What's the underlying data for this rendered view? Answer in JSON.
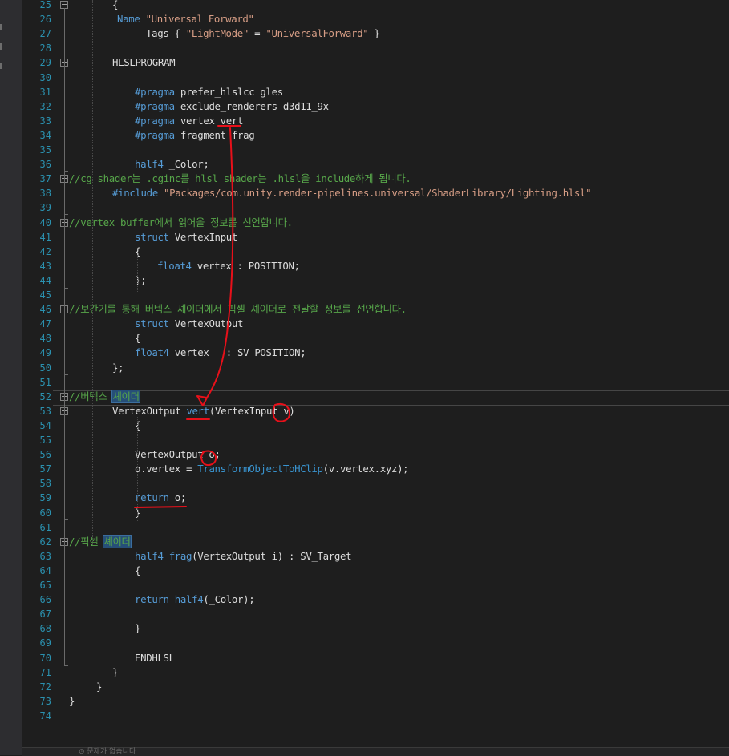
{
  "editor": {
    "lines": [
      {
        "n": "25",
        "segs": [
          {
            "t": "{"
          }
        ]
      },
      {
        "n": "26",
        "segs": [
          {
            "t": "Name ",
            "c": "kw"
          },
          {
            "t": "\"Universal Forward\"",
            "c": "str"
          }
        ]
      },
      {
        "n": "27",
        "segs": [
          {
            "t": "Tags { ",
            "c": ""
          },
          {
            "t": "\"LightMode\"",
            "c": "str"
          },
          {
            "t": " = "
          },
          {
            "t": "\"UniversalForward\"",
            "c": "str"
          },
          {
            "t": " }"
          }
        ]
      },
      {
        "n": "28",
        "segs": []
      },
      {
        "n": "29",
        "segs": [
          {
            "t": "HLSLPROGRAM"
          }
        ]
      },
      {
        "n": "30",
        "segs": []
      },
      {
        "n": "31",
        "segs": [
          {
            "t": "#pragma",
            "c": "kw"
          },
          {
            "t": " prefer_hlslcc gles"
          }
        ]
      },
      {
        "n": "32",
        "segs": [
          {
            "t": "#pragma",
            "c": "kw"
          },
          {
            "t": " exclude_renderers d3d11_9x"
          }
        ]
      },
      {
        "n": "33",
        "segs": [
          {
            "t": "#pragma",
            "c": "kw"
          },
          {
            "t": " vertex vert"
          }
        ]
      },
      {
        "n": "34",
        "segs": [
          {
            "t": "#pragma",
            "c": "kw"
          },
          {
            "t": " fragment frag"
          }
        ]
      },
      {
        "n": "35",
        "segs": []
      },
      {
        "n": "36",
        "segs": [
          {
            "t": "half4",
            "c": "kw"
          },
          {
            "t": " _Color;"
          }
        ]
      },
      {
        "n": "37",
        "segs": [
          {
            "t": "//cg shader는 .cginc를 hlsl shader는 .hlsl을 include하게 됩니다.",
            "c": "cm"
          }
        ]
      },
      {
        "n": "38",
        "segs": [
          {
            "t": "#include",
            "c": "kw"
          },
          {
            "t": " "
          },
          {
            "t": "\"Packages/com.unity.render-pipelines.universal/ShaderLibrary/Lighting.hlsl\"",
            "c": "str"
          }
        ]
      },
      {
        "n": "39",
        "segs": []
      },
      {
        "n": "40",
        "segs": [
          {
            "t": "//vertex buffer에서 읽어올 정보를 선언합니다.",
            "c": "cm"
          }
        ]
      },
      {
        "n": "41",
        "segs": [
          {
            "t": "struct",
            "c": "kw"
          },
          {
            "t": " VertexInput"
          }
        ]
      },
      {
        "n": "42",
        "segs": [
          {
            "t": "{"
          }
        ]
      },
      {
        "n": "43",
        "segs": [
          {
            "t": "float4",
            "c": "kw"
          },
          {
            "t": " vertex : POSITION;"
          }
        ]
      },
      {
        "n": "44",
        "segs": [
          {
            "t": "};"
          }
        ]
      },
      {
        "n": "45",
        "segs": []
      },
      {
        "n": "46",
        "segs": [
          {
            "t": "//보간기를 통해 버텍스 셰이더에서 픽셀 셰이더로 전달할 정보를 선언합니다.",
            "c": "cm"
          }
        ]
      },
      {
        "n": "47",
        "segs": [
          {
            "t": "struct",
            "c": "kw"
          },
          {
            "t": " VertexOutput"
          }
        ]
      },
      {
        "n": "48",
        "segs": [
          {
            "t": "{"
          }
        ]
      },
      {
        "n": "49",
        "segs": [
          {
            "t": "float4",
            "c": "kw"
          },
          {
            "t": " vertex   : SV_POSITION;"
          }
        ]
      },
      {
        "n": "50",
        "segs": [
          {
            "t": "};"
          }
        ]
      },
      {
        "n": "51",
        "segs": []
      },
      {
        "n": "52",
        "segs": [
          {
            "t": "//버텍스 ",
            "c": "cm"
          },
          {
            "t": "셰이더",
            "c": "cm hl"
          }
        ]
      },
      {
        "n": "53",
        "segs": [
          {
            "t": "VertexOutput "
          },
          {
            "t": "vert",
            "c": "kw"
          },
          {
            "t": "(VertexInput v)"
          }
        ]
      },
      {
        "n": "54",
        "segs": [
          {
            "t": "{"
          }
        ]
      },
      {
        "n": "55",
        "segs": []
      },
      {
        "n": "56",
        "segs": [
          {
            "t": "VertexOutput o;"
          }
        ]
      },
      {
        "n": "57",
        "segs": [
          {
            "t": "o.vertex = "
          },
          {
            "t": "TransformObjectToHClip",
            "c": "fn"
          },
          {
            "t": "(v.vertex.xyz);"
          }
        ]
      },
      {
        "n": "58",
        "segs": []
      },
      {
        "n": "59",
        "segs": [
          {
            "t": "return",
            "c": "kw"
          },
          {
            "t": " o;"
          }
        ]
      },
      {
        "n": "60",
        "segs": [
          {
            "t": "}"
          }
        ]
      },
      {
        "n": "61",
        "segs": []
      },
      {
        "n": "62",
        "segs": [
          {
            "t": "//픽셀 ",
            "c": "cm"
          },
          {
            "t": "셰이더",
            "c": "cm hl"
          }
        ]
      },
      {
        "n": "63",
        "segs": [
          {
            "t": "half4",
            "c": "kw"
          },
          {
            "t": " "
          },
          {
            "t": "frag",
            "c": "kw"
          },
          {
            "t": "(VertexOutput i) : SV_Target"
          }
        ]
      },
      {
        "n": "64",
        "segs": [
          {
            "t": "{"
          }
        ]
      },
      {
        "n": "65",
        "segs": []
      },
      {
        "n": "66",
        "segs": [
          {
            "t": "return",
            "c": "kw"
          },
          {
            "t": " "
          },
          {
            "t": "half4",
            "c": "kw"
          },
          {
            "t": "(_Color);"
          }
        ]
      },
      {
        "n": "67",
        "segs": []
      },
      {
        "n": "68",
        "segs": [
          {
            "t": "}"
          }
        ]
      },
      {
        "n": "69",
        "segs": []
      },
      {
        "n": "70",
        "segs": [
          {
            "t": "ENDHLSL"
          }
        ]
      },
      {
        "n": "71",
        "segs": [
          {
            "t": "}"
          }
        ]
      },
      {
        "n": "72",
        "segs": [
          {
            "t": "}"
          }
        ]
      },
      {
        "n": "73",
        "segs": [
          {
            "t": "}"
          }
        ]
      },
      {
        "n": "74",
        "segs": []
      }
    ]
  },
  "colors": {
    "background": "#1e1e1e",
    "line_number": "#2b91af",
    "keyword": "#569cd6",
    "string": "#d69d85",
    "comment": "#57a64a",
    "function": "#3994d0",
    "annotation_red": "#e8101a"
  },
  "status": {
    "text": "⊙ 문제가 없습니다"
  }
}
